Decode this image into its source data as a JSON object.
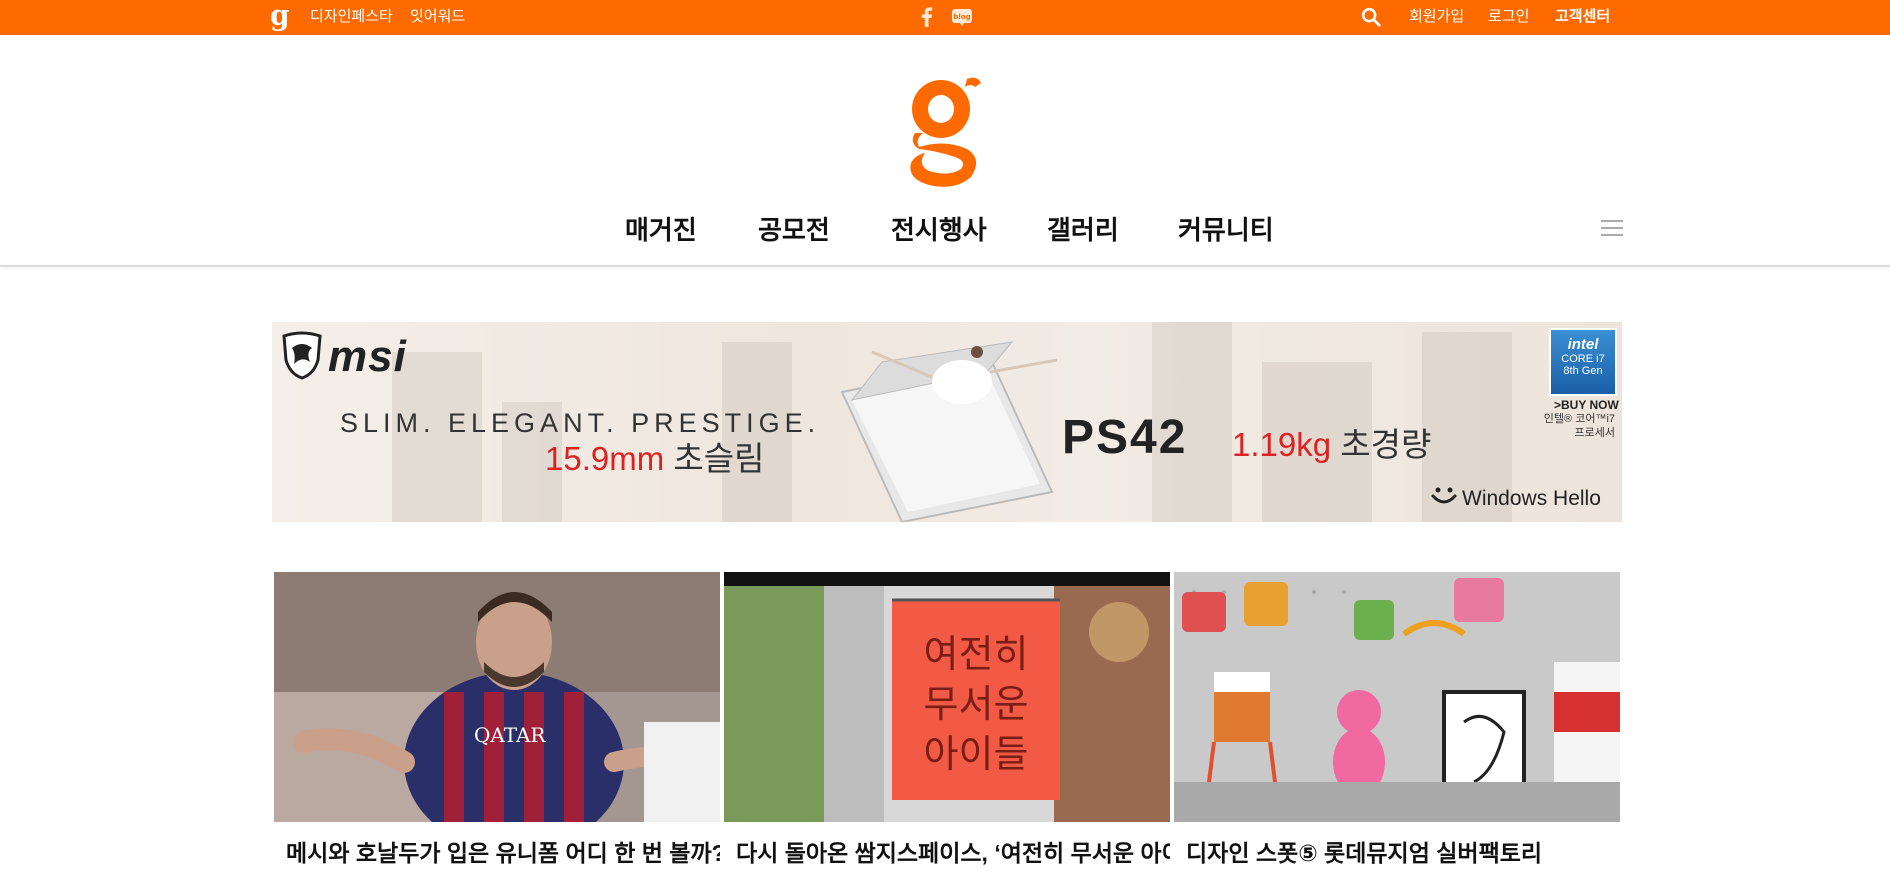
{
  "topbar": {
    "logo": "g",
    "links": [
      "디자인페스타",
      "잇어워드"
    ],
    "right_links": [
      "회원가입",
      "로그인",
      "고객센터"
    ],
    "icons": [
      "facebook-icon",
      "blog-icon",
      "search-icon"
    ]
  },
  "header": {
    "logo": "g",
    "nav": [
      "매거진",
      "공모전",
      "전시행사",
      "갤러리",
      "커뮤니티"
    ]
  },
  "banner": {
    "brand": "msi",
    "tagline": "SLIM. ELEGANT. PRESTIGE.",
    "thickness_value": "15.9mm",
    "thickness_label": "초슬림",
    "model": "PS42",
    "weight_value": "1.19kg",
    "weight_label": "초경량",
    "hello": "Windows Hello",
    "intel_brand": "intel",
    "intel_core": "CORE i7",
    "intel_gen": "8th Gen",
    "buy_now": ">BUY NOW",
    "intel_sub1": "인텔® 코어™i7",
    "intel_sub2": "프로세서"
  },
  "cards": [
    {
      "title": "메시와 호날두가 입은 유니폼 어디 한 번 볼까?"
    },
    {
      "title": "다시 돌아온 쌈지스페이스, ‘여전히 무서운 아이"
    },
    {
      "title": "디자인 스폿⑤ 롯데뮤지엄 실버팩토리"
    }
  ],
  "card2_sign": {
    "line1": "여전히",
    "line2": "무서운",
    "line3": "아이들"
  },
  "colors": {
    "brand": "#ff6a00",
    "header_line": "#dcdcdc"
  }
}
